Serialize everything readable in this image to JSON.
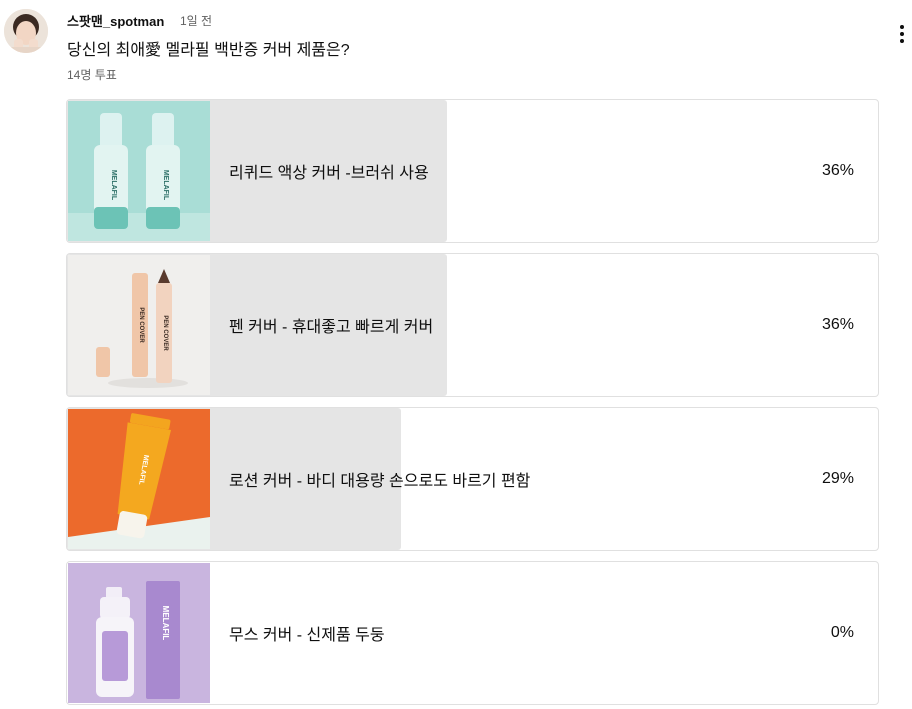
{
  "post": {
    "author": "스팟맨_spotman",
    "time": "1일 전",
    "question": "당신의 최애愛 멜라필 백반증 커버 제품은?",
    "votes": "14명 투표",
    "avatar_icon": "profile-photo",
    "menu_icon": "more-vert-icon"
  },
  "poll": {
    "options": [
      {
        "label": "리퀴드 액상 커버 -브러쉬 사용",
        "percent": "36%",
        "share": 0.36,
        "image": "liquid-cover-bottles",
        "image_bg": "#a9ddd6"
      },
      {
        "label": "펜 커버 - 휴대좋고 빠르게 커버",
        "percent": "36%",
        "share": 0.36,
        "image": "pen-cover-sticks",
        "image_bg": "#f0efed"
      },
      {
        "label": "로션 커버 - 바디 대용량 손으로도 바르기 편함",
        "percent": "29%",
        "share": 0.29,
        "image": "lotion-cover-tube",
        "image_bg": "#ec6a2c"
      },
      {
        "label": "무스 커버 - 신제품 두둥",
        "percent": "0%",
        "share": 0.0,
        "image": "mousse-cover-bottle-box",
        "image_bg": "#c9b5df"
      }
    ]
  },
  "product_text": {
    "brand": "MELAFIL",
    "pen_label": "PEN COVER"
  }
}
